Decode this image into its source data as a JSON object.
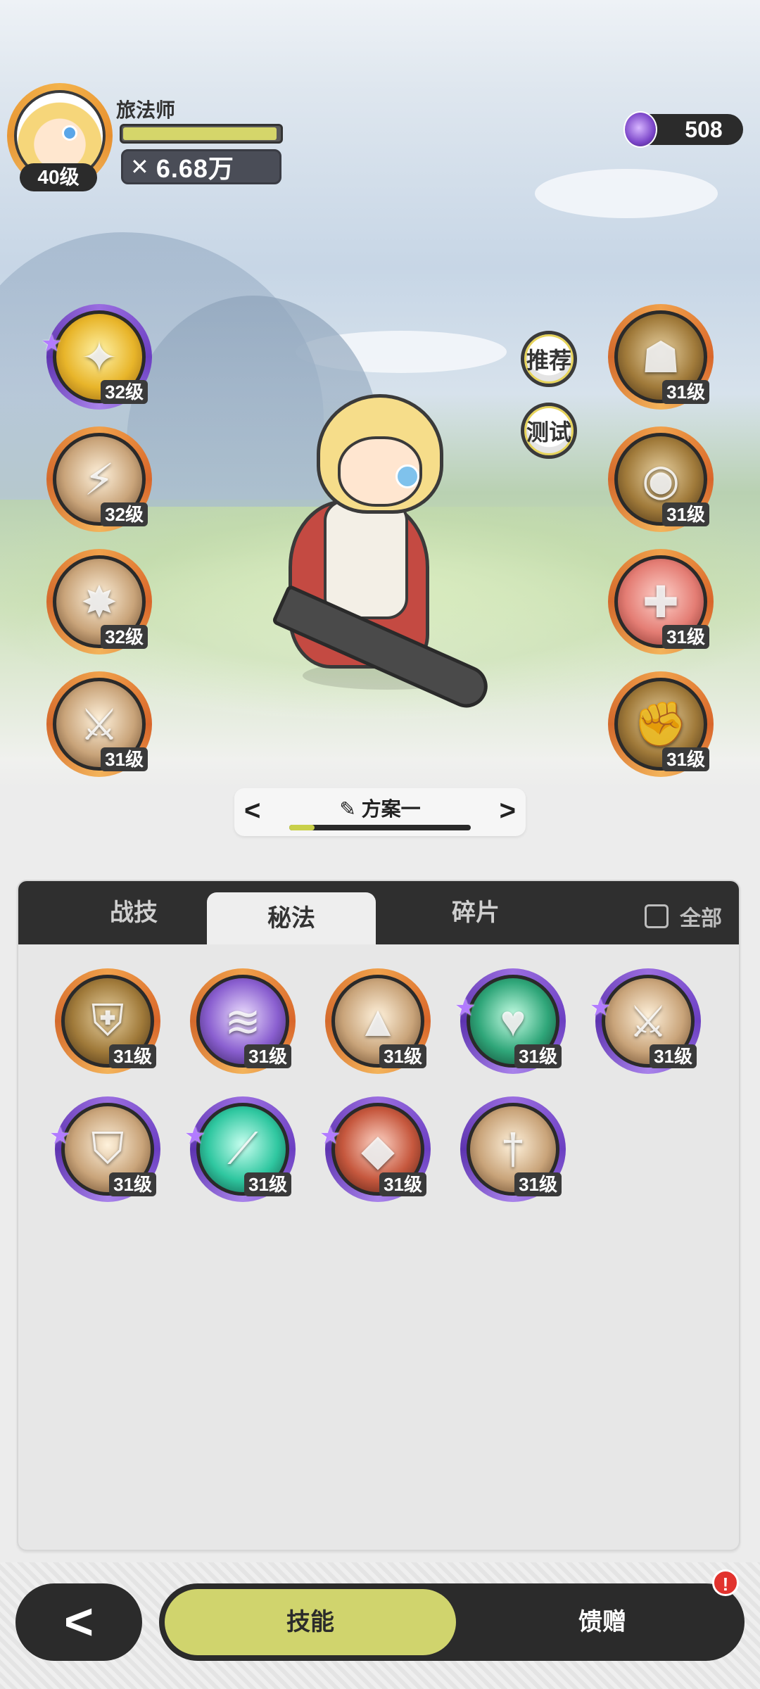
{
  "player": {
    "name": "旅法师",
    "level": "40级",
    "hp_fraction": 0.98,
    "power_icon": "crossed-swords-icon",
    "power": "6.68万"
  },
  "currency": {
    "icon": "purple-crystal-icon",
    "value": "508"
  },
  "side_buttons": {
    "recommend": "推荐",
    "test": "测试"
  },
  "left_skills": [
    {
      "level": "32级",
      "frame": "purple",
      "theme": "gold",
      "icon": "star-burst-icon",
      "glyph": "✦",
      "starred": true
    },
    {
      "level": "32级",
      "frame": "orange",
      "theme": "tan",
      "icon": "light-rays-icon",
      "glyph": "⚡",
      "starred": false
    },
    {
      "level": "32级",
      "frame": "orange",
      "theme": "tan",
      "icon": "explosion-icon",
      "glyph": "✸",
      "starred": false
    },
    {
      "level": "31级",
      "frame": "orange",
      "theme": "tan",
      "icon": "sword-slash-icon",
      "glyph": "⚔",
      "starred": false
    }
  ],
  "right_skills": [
    {
      "level": "31级",
      "frame": "orange",
      "theme": "brown",
      "icon": "golem-icon",
      "glyph": "☗",
      "starred": false
    },
    {
      "level": "31级",
      "frame": "orange",
      "theme": "brown",
      "icon": "eye-icon",
      "glyph": "◉",
      "starred": false
    },
    {
      "level": "31级",
      "frame": "orange",
      "theme": "red",
      "icon": "sword-heal-icon",
      "glyph": "✚",
      "starred": false
    },
    {
      "level": "31级",
      "frame": "orange",
      "theme": "brown",
      "icon": "arm-icon",
      "glyph": "✊",
      "starred": false
    }
  ],
  "loadout": {
    "prev": "<",
    "next": ">",
    "edit_icon": "pencil-icon",
    "name": "方案一",
    "progress": 0.14
  },
  "tabs": [
    {
      "label": "战技",
      "active": false
    },
    {
      "label": "秘法",
      "active": true
    },
    {
      "label": "碎片",
      "active": false
    }
  ],
  "show_all": {
    "label": "全部",
    "checked": false
  },
  "grid_skills": [
    {
      "level": "31级",
      "frame": "orange",
      "theme": "brown",
      "icon": "armor-icon",
      "glyph": "⛨",
      "starred": false
    },
    {
      "level": "31级",
      "frame": "orange",
      "theme": "purple",
      "icon": "shadow-beast-icon",
      "glyph": "≋",
      "starred": false
    },
    {
      "level": "31级",
      "frame": "orange",
      "theme": "tan",
      "icon": "blade-icon",
      "glyph": "▲",
      "starred": false
    },
    {
      "level": "31级",
      "frame": "purple",
      "theme": "green",
      "icon": "heart-heal-icon",
      "glyph": "♥",
      "starred": true
    },
    {
      "level": "31级",
      "frame": "purple",
      "theme": "tan",
      "icon": "sword-up-icon",
      "glyph": "⚔",
      "starred": true
    },
    {
      "level": "31级",
      "frame": "purple",
      "theme": "tan",
      "icon": "shield-heart-icon",
      "glyph": "⛉",
      "starred": true
    },
    {
      "level": "31级",
      "frame": "purple",
      "theme": "teal",
      "icon": "green-sword-icon",
      "glyph": "⟋",
      "starred": true
    },
    {
      "level": "31级",
      "frame": "purple",
      "theme": "rust",
      "icon": "crystal-icon",
      "glyph": "◆",
      "starred": true
    },
    {
      "level": "31级",
      "frame": "purple",
      "theme": "tan",
      "icon": "dagger-icon",
      "glyph": "†",
      "starred": false
    }
  ],
  "bottom": {
    "back_icon": "back-arrow-icon",
    "back_glyph": "<",
    "active": "技能",
    "inactive": "馈赠",
    "alert": "!"
  },
  "colors": {
    "accent": "#d0d46d",
    "dark": "#2b2b2b",
    "frame_orange": "#e07a34",
    "frame_purple": "#7b4dd0",
    "alert": "#e2332e"
  }
}
